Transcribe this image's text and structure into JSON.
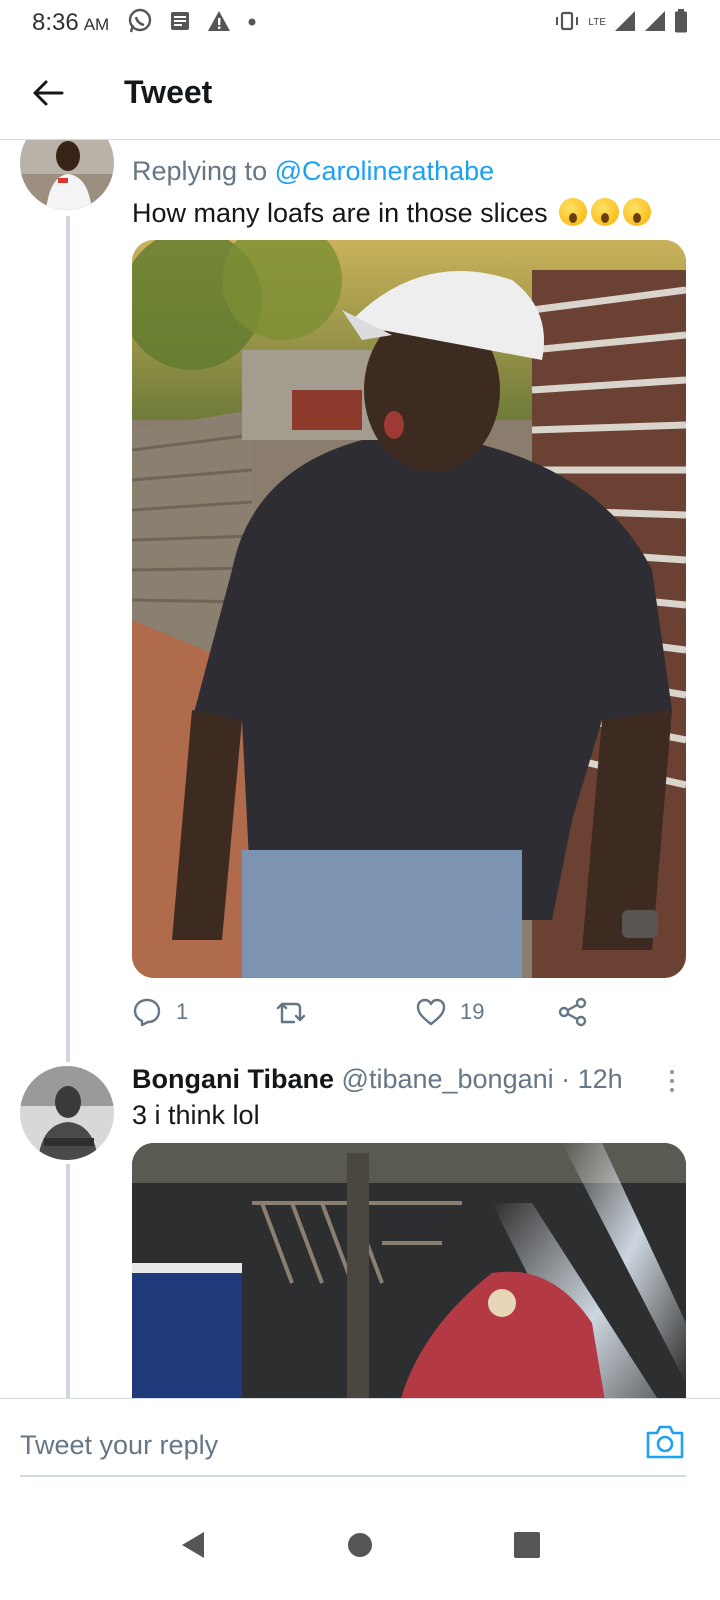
{
  "status_bar": {
    "time": "8:36",
    "ampm": "AM",
    "network": "LTE"
  },
  "header": {
    "title": "Tweet"
  },
  "tweet1": {
    "replying_prefix": "Replying to ",
    "replying_to": "@Carolinerathabe",
    "text": "How many loafs are in those slices",
    "emojis": [
      "astonished-face",
      "astonished-face",
      "astonished-face"
    ],
    "replies": "1",
    "retweets": "",
    "likes": "19"
  },
  "tweet2": {
    "name": "Bongani Tibane",
    "handle": "@tibane_bongani",
    "time": "· 12h",
    "text": "3 i think lol"
  },
  "composer": {
    "placeholder": "Tweet your reply"
  },
  "colors": {
    "accent": "#1da1f2",
    "secondary_text": "#657786",
    "divider": "#d6dbe0"
  }
}
